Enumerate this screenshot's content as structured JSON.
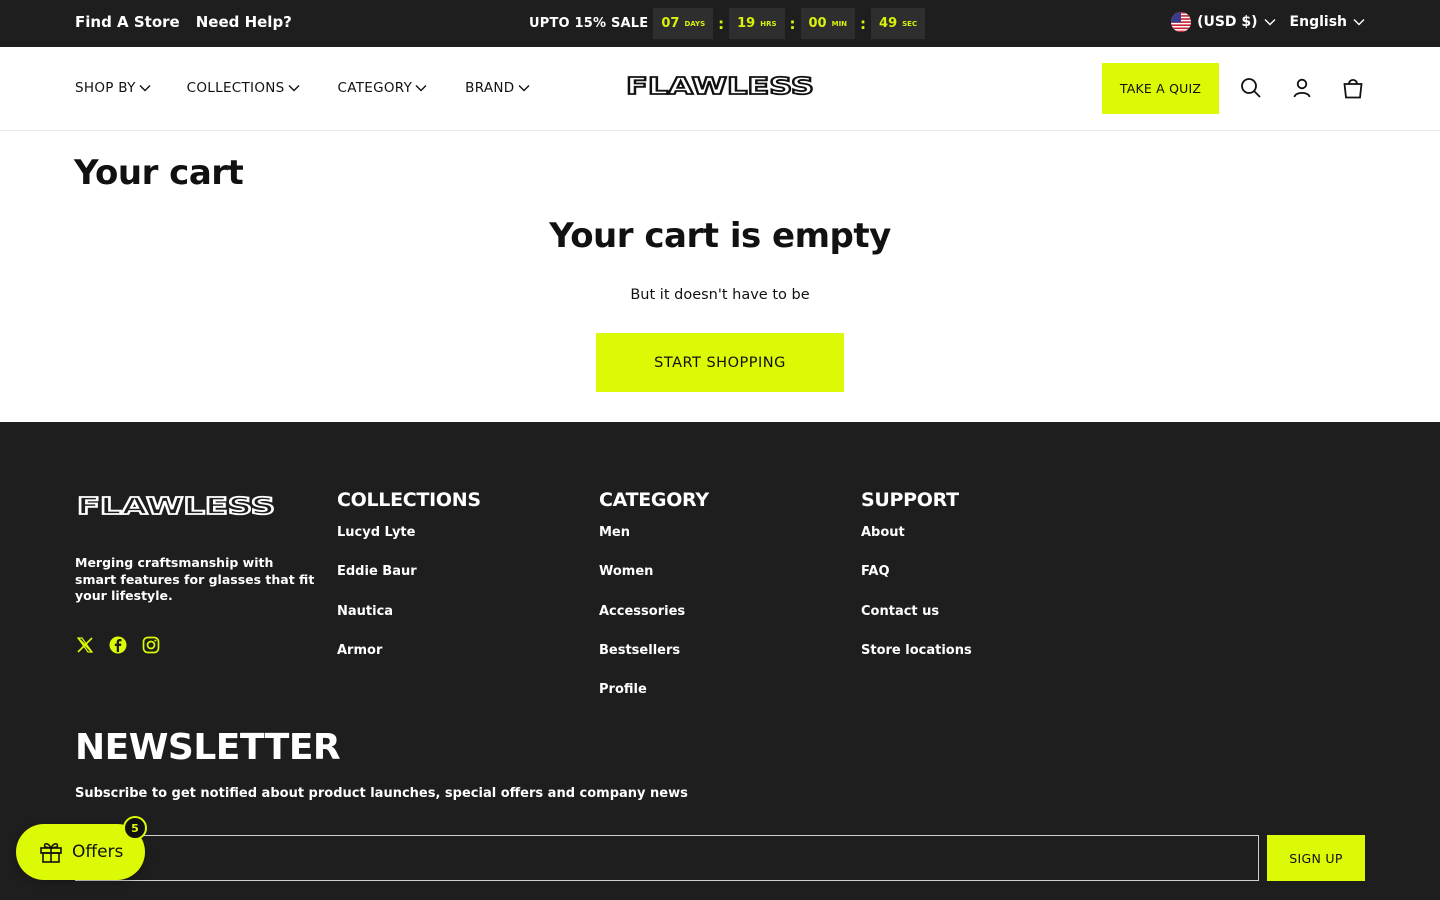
{
  "announcement": {
    "find_store": "Find A Store",
    "need_help": "Need Help?",
    "sale_label": "UPTO 15% SALE",
    "timer": [
      {
        "value": "07",
        "unit": "DAYS"
      },
      {
        "value": "19",
        "unit": "HRS"
      },
      {
        "value": "00",
        "unit": "MIN"
      },
      {
        "value": "49",
        "unit": "SEC"
      }
    ],
    "separator": ":",
    "currency": "(USD $)",
    "language": "English"
  },
  "header": {
    "nav": [
      "SHOP BY",
      "COLLECTIONS",
      "CATEGORY",
      "BRAND"
    ],
    "logo": "FLAWLESS",
    "quiz_label": "TAKE A QUIZ"
  },
  "cart": {
    "title": "Your cart",
    "empty_title": "Your cart is empty",
    "empty_sub": "But it doesn't have to be",
    "cta": "START SHOPPING"
  },
  "footer": {
    "logo": "FLAWLESS",
    "tagline": "Merging craftsmanship with smart features for glasses that fit your lifestyle.",
    "socials": [
      "x-icon",
      "facebook-icon",
      "instagram-icon"
    ],
    "columns": [
      {
        "title": "COLLECTIONS",
        "links": [
          "Lucyd Lyte",
          "Eddie Baur",
          "Nautica",
          "Armor"
        ]
      },
      {
        "title": "CATEGORY",
        "links": [
          "Men",
          "Women",
          "Accessories",
          "Bestsellers",
          "Profile"
        ]
      },
      {
        "title": "SUPPORT",
        "links": [
          "About",
          "FAQ",
          "Contact us",
          "Store locations"
        ]
      }
    ],
    "newsletter": {
      "title": "NEWSLETTER",
      "subtitle": "Subscribe to get notified about product launches, special offers and company news",
      "email_value": "",
      "signup_label": "SIGN UP"
    }
  },
  "offers_widget": {
    "label": "Offers",
    "count": "5"
  },
  "colors": {
    "accent": "#dcfa06",
    "dark": "#1e1e1e"
  }
}
